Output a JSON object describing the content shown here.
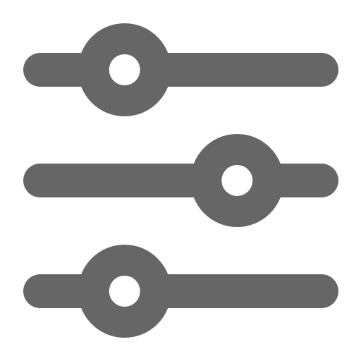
{
  "icon": {
    "name": "sliders-icon",
    "color": "#666666",
    "background": "#ffffff"
  },
  "sliders": [
    {
      "name": "slider-1",
      "level": 0.3
    },
    {
      "name": "slider-2",
      "level": 0.7
    },
    {
      "name": "slider-3",
      "level": 0.3
    }
  ]
}
